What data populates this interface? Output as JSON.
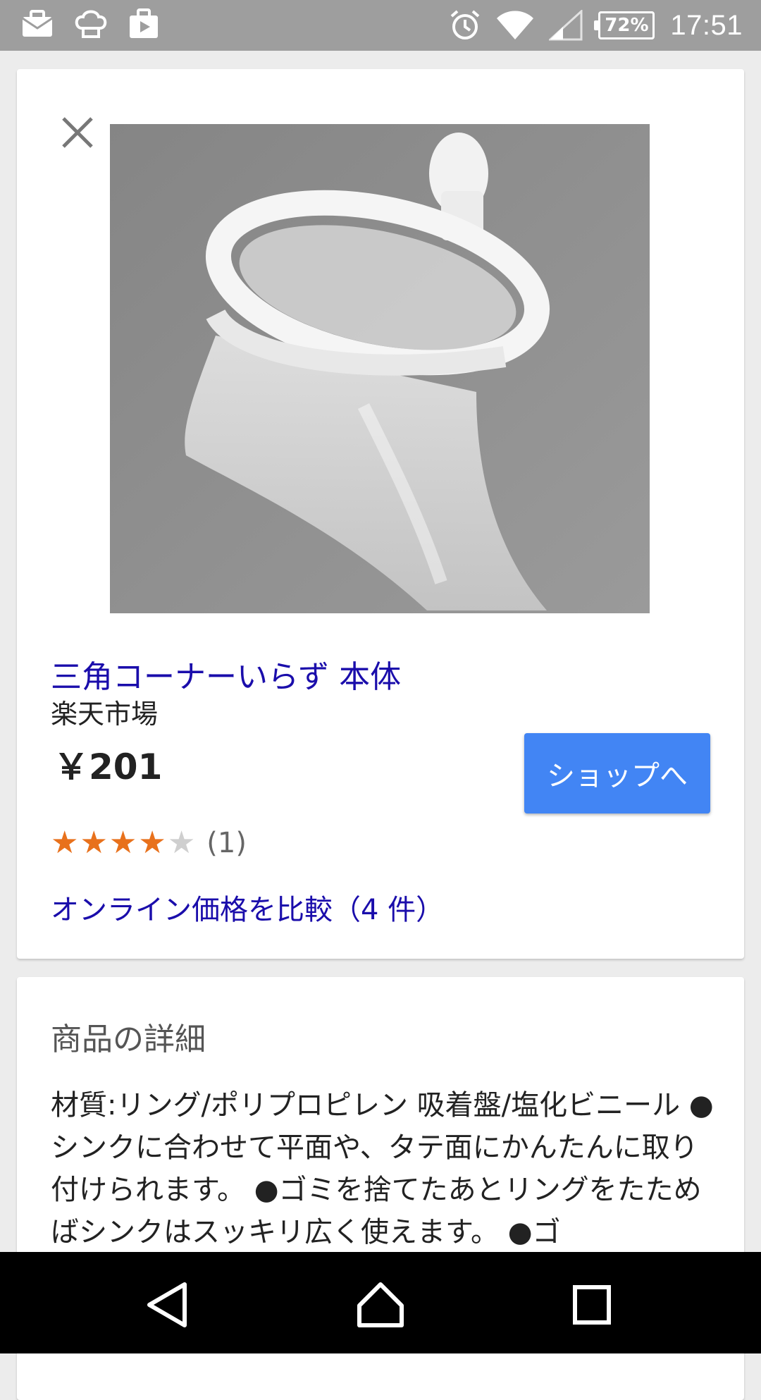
{
  "status_bar": {
    "battery": "72%",
    "time": "17:51",
    "icons": [
      "mail-icon",
      "chef-hat-icon",
      "play-store-icon",
      "alarm-icon",
      "wifi-icon",
      "signal-icon",
      "battery-icon"
    ]
  },
  "product": {
    "title": "三角コーナーいらず 本体",
    "merchant": "楽天市場",
    "price": "￥201",
    "shop_button_label": "ショップへ",
    "rating": {
      "stars": 4,
      "max": 5,
      "count": "(1)"
    },
    "compare_link": "オンライン価格を比較（4 件）"
  },
  "details": {
    "heading": "商品の詳細",
    "text": "材質:リング/ポリプロピレン 吸着盤/塩化ビニール ●シンクに合わせて平面や、タテ面にかんたんに取り付けられます。 ●ゴミを捨てたあとリングをたためばシンクはスッキリ広く使えます。 ●ゴ"
  },
  "colors": {
    "status_bar_bg": "#9e9e9e",
    "link": "#1a0dab",
    "button": "#4285f4",
    "star_on": "#e8711c",
    "star_off": "#cfcfcf"
  },
  "nav": {
    "icons": [
      "back-icon",
      "home-icon",
      "recents-icon"
    ]
  }
}
